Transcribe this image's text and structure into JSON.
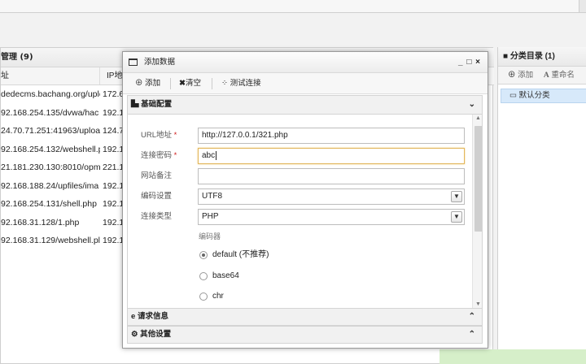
{
  "left_panel": {
    "title": "管理 (9)",
    "columns": [
      "址",
      "IP地"
    ],
    "rows": [
      {
        "url": "dedecms.bachang.org/uplc",
        "ip": "172.6"
      },
      {
        "url": "92.168.254.135/dvwa/hac",
        "ip": "192.1"
      },
      {
        "url": "24.70.71.251:41963/uploa",
        "ip": "124.7"
      },
      {
        "url": "92.168.254.132/webshell.p",
        "ip": "192.1"
      },
      {
        "url": "21.181.230.130:8010/opm",
        "ip": "221.1"
      },
      {
        "url": "92.168.188.24/upfiles/ima",
        "ip": "192.1"
      },
      {
        "url": "92.168.254.131/shell.php",
        "ip": "192.1"
      },
      {
        "url": "92.168.31.128/1.php",
        "ip": "192.1"
      },
      {
        "url": "92.168.31.129/webshell.pl",
        "ip": "192.1"
      }
    ]
  },
  "right_panel": {
    "title": "分类目录 (1)",
    "add_label": "添加",
    "rename_label": "重命名",
    "category": "默认分类"
  },
  "dialog": {
    "title": "添加数据",
    "controls": "_ □ ×",
    "toolbar": {
      "add": "添加",
      "clear": "清空",
      "test": "测试连接"
    },
    "section_basic": "基础配置",
    "fields": {
      "url_label": "URL地址",
      "url_value": "http://127.0.0.1/321.php",
      "password_label": "连接密码",
      "password_value": "abc",
      "note_label": "网站备注",
      "note_value": "",
      "encoding_label": "编码设置",
      "encoding_value": "UTF8",
      "type_label": "连接类型",
      "type_value": "PHP",
      "encoder_label": "编码器",
      "encoders": [
        "default (不推荐)",
        "base64",
        "chr"
      ],
      "selected_encoder": "default (不推荐)"
    },
    "required_mark": "*",
    "section_request": "请求信息",
    "section_other": "其他设置"
  },
  "colors": {
    "accent_required": "#d02020",
    "category_highlight": "#d7e9fa",
    "focus_border": "#e2b65a",
    "toast": "#d6efc9"
  }
}
